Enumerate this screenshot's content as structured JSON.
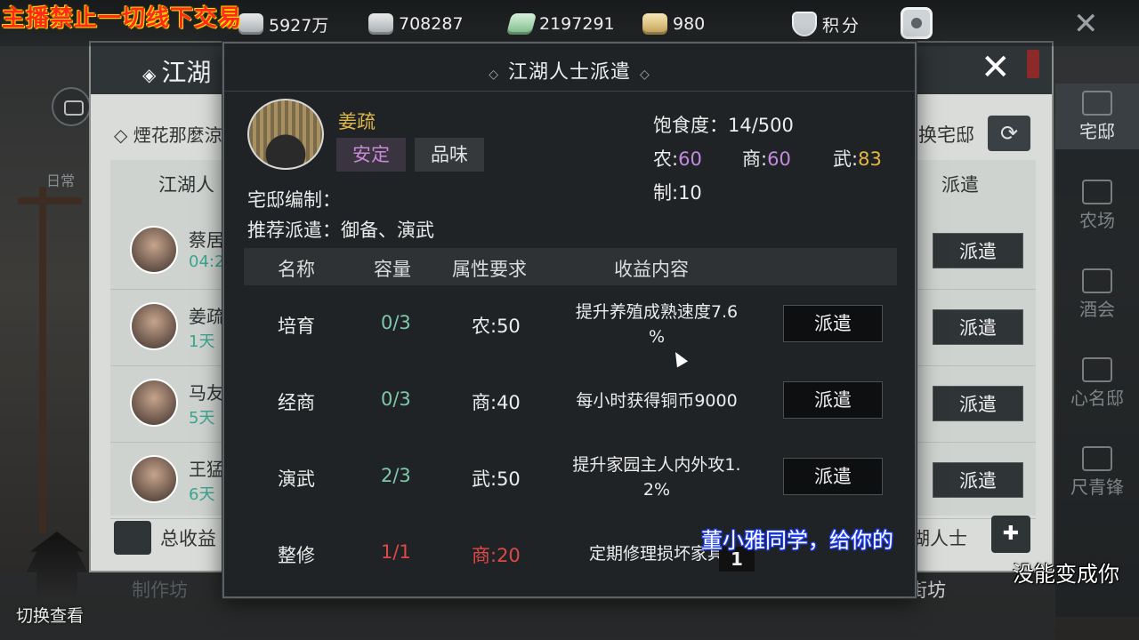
{
  "overlay": {
    "warning": "主播禁止一切线下交易",
    "danmu_1": "董小雅同学，给你的",
    "danmu_2": "没能变成你"
  },
  "resources": [
    {
      "icon": "silver-coin-icon",
      "value": "5927万"
    },
    {
      "icon": "silver-ingot-icon",
      "value": "708287"
    },
    {
      "icon": "jade-ticket-icon",
      "value": "2197291"
    },
    {
      "icon": "gold-ingot-icon",
      "value": "980"
    }
  ],
  "points_label": "积分",
  "left_side": {
    "daily": "日常",
    "switch_view": "切换查看"
  },
  "right_side": [
    "宅邸",
    "农场",
    "酒会",
    "心名邸",
    "尺青锋"
  ],
  "background_window": {
    "title": "江湖",
    "subtitle": "煙花那麼涼",
    "swap_label": "换宅邸",
    "col_left": "江湖人",
    "col_right": "派遣",
    "rows": [
      {
        "name": "蔡居",
        "time": "04:2",
        "button": "派遣"
      },
      {
        "name": "姜疏",
        "time": "1天",
        "button": "派遣"
      },
      {
        "name": "马友",
        "time": "5天",
        "button": "派遣"
      },
      {
        "name": "王猛",
        "time": "6天",
        "button": "派遣"
      }
    ],
    "total_label": "总收益",
    "lake_label": "湖人士",
    "bottom_left": "制作坊",
    "bottom_right": "看街坊"
  },
  "modal": {
    "title": "江湖人士派遣",
    "character": {
      "name": "姜疏",
      "tag_status": "安定",
      "tag_taste": "品味",
      "house_label": "宅邸编制：",
      "recommend_label": "推荐派遣：御备、演武"
    },
    "stats": {
      "satiety_label": "饱食度：",
      "satiety_value": "14/500",
      "nong_label": "农:",
      "nong_value": "60",
      "shang_label": "商:",
      "shang_value": "60",
      "wu_label": "武:",
      "wu_value": "83",
      "zhi_label": "制:10"
    },
    "table_headers": [
      "名称",
      "容量",
      "属性要求",
      "收益内容"
    ],
    "rows": [
      {
        "name": "培育",
        "capacity": "0/3",
        "requirement": "农:50",
        "desc_1": "提升养殖成熟速度7.6",
        "desc_2": "%",
        "button": "派遣"
      },
      {
        "name": "经商",
        "capacity": "0/3",
        "requirement": "商:40",
        "desc_1": "每小时获得铜币9000",
        "desc_2": "",
        "button": "派遣"
      },
      {
        "name": "演武",
        "capacity": "2/3",
        "requirement": "武:50",
        "desc_1": "提升家园主人内外攻1.",
        "desc_2": "2%",
        "button": "派遣"
      },
      {
        "name": "整修",
        "capacity": "1/1",
        "requirement": "商:20",
        "desc_1": "定期修理损坏家具",
        "desc_2": "",
        "button": ""
      }
    ],
    "badge": "1"
  }
}
